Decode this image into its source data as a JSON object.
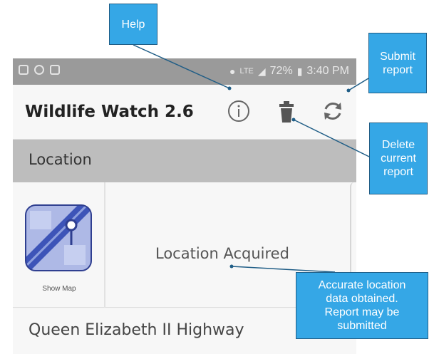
{
  "status_bar": {
    "network": "LTE",
    "battery": "72%",
    "time": "3:40 PM"
  },
  "app_bar": {
    "title": "Wildlife Watch 2.6",
    "info_icon": "info-icon",
    "delete_icon": "trash-icon",
    "sync_icon": "sync-icon"
  },
  "location_section": {
    "header": "Location",
    "map_label": "Show Map",
    "status": "Location Acquired"
  },
  "road": {
    "name": "Queen Elizabeth II Highway"
  },
  "callouts": {
    "help": "Help",
    "submit": "Submit\nreport",
    "delete": "Delete\ncurrent\nreport",
    "location": "Accurate location\ndata obtained.\nReport may be\nsubmitted"
  },
  "colors": {
    "callout_fill": "#35a7e6",
    "status_bar": "#9a9a9a",
    "section_header": "#bdbdbd"
  }
}
